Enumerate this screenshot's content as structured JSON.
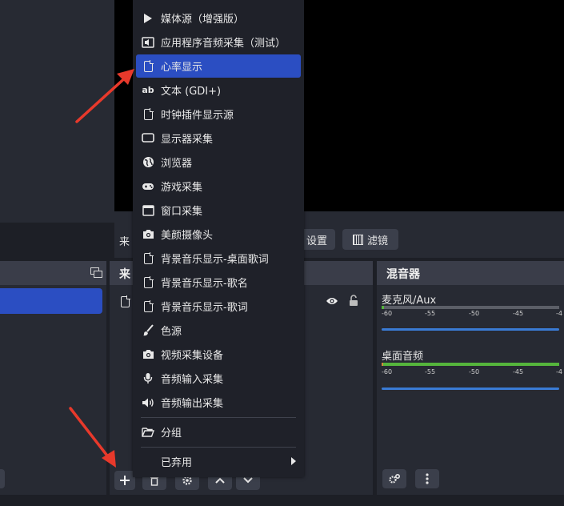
{
  "menu": {
    "items": [
      {
        "label": "媒体源（增强版）",
        "icon": "play-icon"
      },
      {
        "label": "应用程序音频采集（测试）",
        "icon": "app-audio-icon"
      },
      {
        "label": "心率显示",
        "icon": "file-icon",
        "selected": true
      },
      {
        "label": "文本 (GDI+)",
        "icon": "text-ab-icon"
      },
      {
        "label": "时钟插件显示源",
        "icon": "file-icon"
      },
      {
        "label": "显示器采集",
        "icon": "monitor-icon"
      },
      {
        "label": "浏览器",
        "icon": "globe-icon"
      },
      {
        "label": "游戏采集",
        "icon": "gamepad-icon"
      },
      {
        "label": "窗口采集",
        "icon": "window-icon"
      },
      {
        "label": "美颜摄像头",
        "icon": "camera-icon"
      },
      {
        "label": "背景音乐显示-桌面歌词",
        "icon": "file-icon"
      },
      {
        "label": "背景音乐显示-歌名",
        "icon": "file-icon"
      },
      {
        "label": "背景音乐显示-歌词",
        "icon": "file-icon"
      },
      {
        "label": "色源",
        "icon": "brush-icon"
      },
      {
        "label": "视频采集设备",
        "icon": "camera-icon"
      },
      {
        "label": "音频输入采集",
        "icon": "microphone-icon"
      },
      {
        "label": "音频输出采集",
        "icon": "speaker-icon"
      }
    ],
    "group_label": "分组",
    "deprecated_label": "已弃用"
  },
  "toolbar": {
    "source_prefix": "来",
    "settings_label": "设置",
    "filters_label": "滤镜"
  },
  "sources_dock": {
    "title_prefix": "来"
  },
  "mixer": {
    "title": "混音器",
    "channels": [
      {
        "name": "麦克风/Aux"
      },
      {
        "name": "桌面音频"
      }
    ],
    "ticks": [
      "-60",
      "-55",
      "-50",
      "-45",
      "-4"
    ]
  },
  "colors": {
    "accent": "#2b4ec2",
    "meter_green": "#55b53c",
    "slider_blue": "#3a7bd5"
  }
}
